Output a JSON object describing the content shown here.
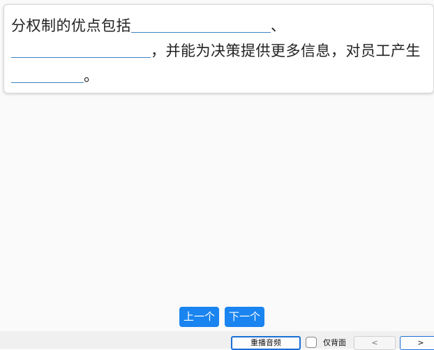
{
  "question": {
    "part1": "分权制的优点包括",
    "part2": "、",
    "part3": "，并能为决策提供更多信息，对员工产生",
    "part4": "。"
  },
  "nav": {
    "prev_label": "上一个",
    "next_label": "下一个"
  },
  "toolbar": {
    "replay_label": "重播音频",
    "back_only_label": "仅背面",
    "back_only_checked": false,
    "prev_page_label": "<",
    "next_page_label": ">"
  },
  "colors": {
    "accent": "#1a84f0",
    "blank_underline": "#3b82c4",
    "focus_border": "#1a6fd6"
  }
}
